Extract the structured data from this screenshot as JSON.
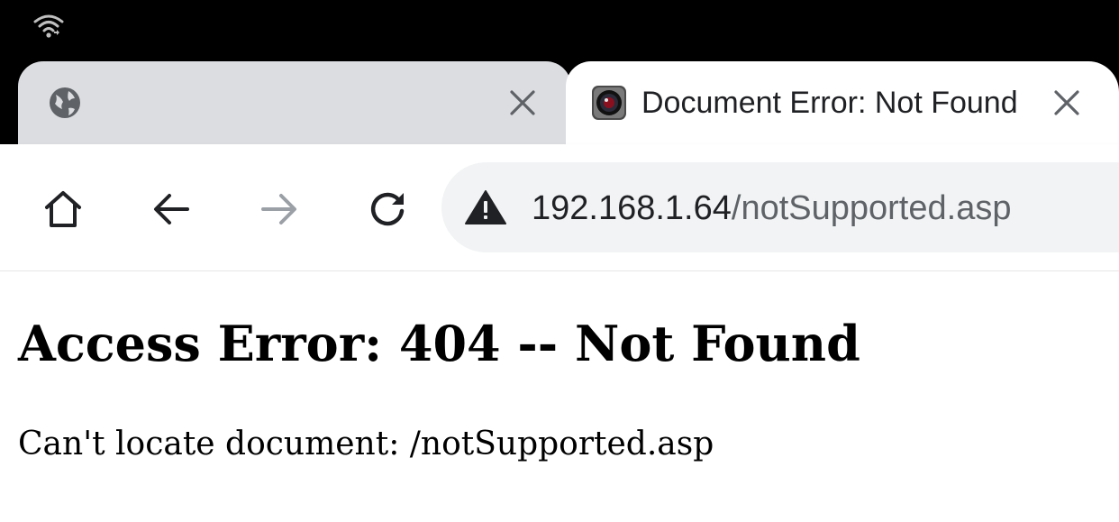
{
  "status_bar": {
    "icons": [
      "wifi-icon"
    ]
  },
  "tabs": [
    {
      "title": "",
      "favicon": "globe-icon",
      "active": false
    },
    {
      "title": "Document Error: Not Found",
      "favicon": "camera-lens-icon",
      "active": true
    }
  ],
  "toolbar": {
    "buttons": [
      "home-icon",
      "back-arrow-icon",
      "forward-arrow-icon",
      "reload-icon"
    ],
    "security_icon": "warning-icon",
    "url_host": "192.168.1.64",
    "url_path": "/notSupported.asp"
  },
  "page": {
    "heading": "Access Error: 404 -- Not Found",
    "message": "Can't locate document: /notSupported.asp"
  },
  "colors": {
    "tab_inactive": "#dcdde1",
    "omnibox": "#f1f3f4",
    "forward_disabled": "#9aa0a6"
  }
}
